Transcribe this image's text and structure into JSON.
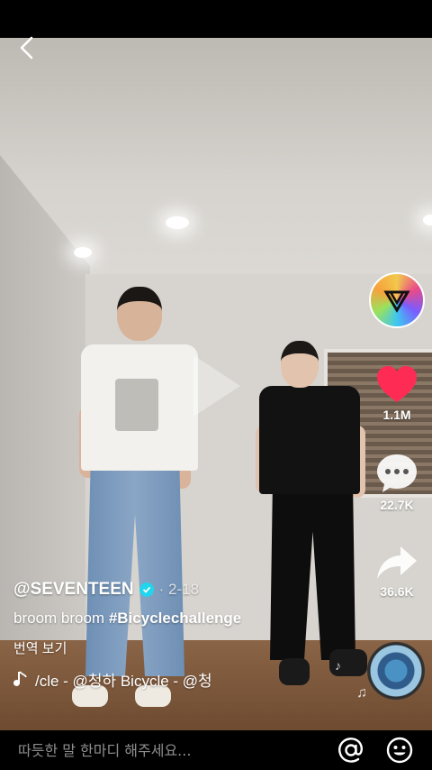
{
  "video": {
    "username": "@SEVENTEEN",
    "date_sep": "·",
    "date": "2-18",
    "description_text": "broom broom ",
    "hashtag": "#Bicyclechallenge",
    "translate_label": "번역 보기",
    "music": "/cle - @청하   Bicycle - @청"
  },
  "actions": {
    "like_count": "1.1M",
    "comment_count": "22.7K",
    "share_count": "36.6K"
  },
  "comment_bar": {
    "placeholder": "따듯한 말 한마디 해주세요..."
  },
  "icons": {
    "back": "chevron-left-icon",
    "like": "heart-icon",
    "comment": "speech-bubble-icon",
    "share": "share-arrow-icon",
    "mention": "at-sign-icon",
    "emoji": "smiley-icon",
    "music": "music-note-icon"
  },
  "colors": {
    "like": "#fe2c55",
    "verified": "#20d5ec"
  }
}
